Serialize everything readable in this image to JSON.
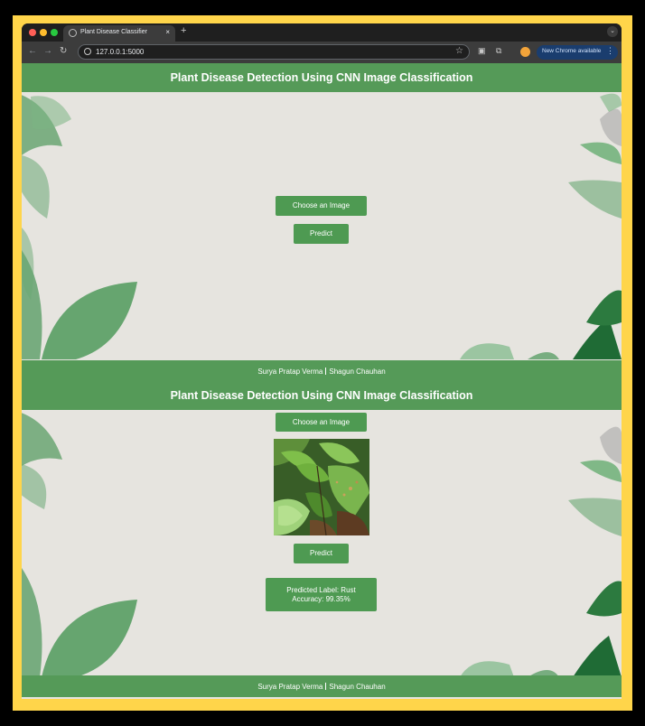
{
  "browser": {
    "tab_title": "Plant Disease Classifier",
    "tab_close": "×",
    "new_tab": "+",
    "url": "127.0.0.1:5000",
    "update_button": "New Chrome available",
    "update_menu": "⋮"
  },
  "icons": {
    "back": "←",
    "forward": "→",
    "reload": "↻",
    "star": "☆",
    "sidebar": "▣",
    "extensions": "⧉"
  },
  "header": {
    "title": "Plant Disease Detection Using CNN Image Classification"
  },
  "form": {
    "choose_label": "Choose an Image",
    "predict_label": "Predict"
  },
  "result": {
    "label_line": "Predicted Label: Rust",
    "accuracy_line": "Accuracy: 99.35%"
  },
  "footer": {
    "author1": "Surya Pratap Verma",
    "author2": "Shagun Chauhan"
  },
  "colors": {
    "accent_green": "#559a58",
    "button_green": "#4e9a52",
    "page_background": "#e6e4df",
    "highlight_frame": "#ffd54a"
  }
}
